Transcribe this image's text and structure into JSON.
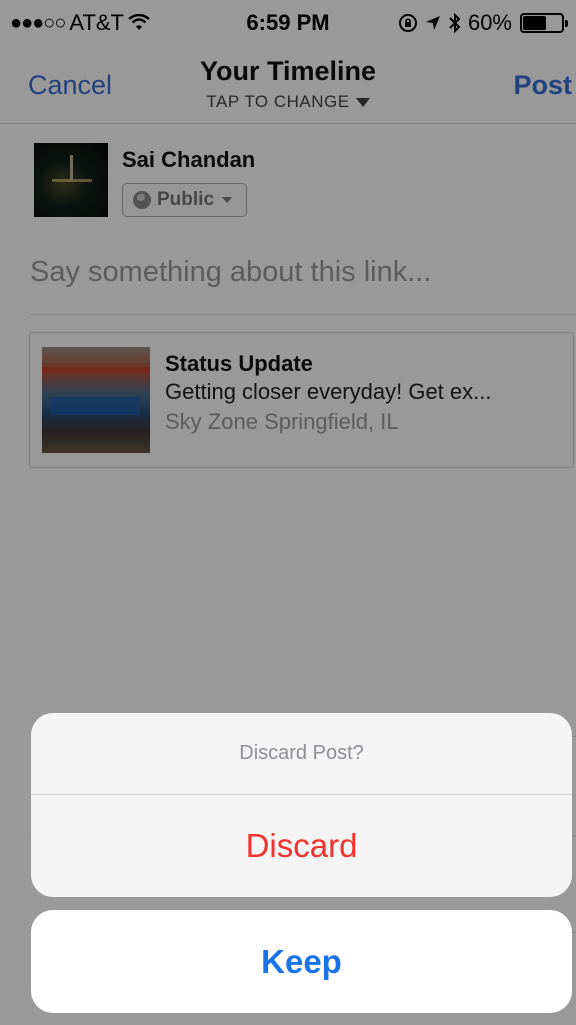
{
  "status_bar": {
    "signal": "●●●○○",
    "carrier": "AT&T",
    "wifi_icon": "wifi-icon",
    "time": "6:59 PM",
    "battery_percent": "60%",
    "battery_level": 0.6
  },
  "nav": {
    "cancel_label": "Cancel",
    "title": "Your Timeline",
    "subtitle": "TAP TO CHANGE",
    "post_label": "Post"
  },
  "composer": {
    "author_name": "Sai Chandan",
    "audience": "Public",
    "placeholder": "Say something about this link..."
  },
  "link_preview": {
    "title": "Status Update",
    "description": "Getting closer everyday! Get ex...",
    "source": "Sky Zone Springfield, IL"
  },
  "action_sheet": {
    "title": "Discard Post?",
    "discard_label": "Discard",
    "keep_label": "Keep"
  },
  "colors": {
    "link_blue": "#3b6fd1",
    "destructive_red": "#f0322e",
    "action_blue": "#1a73e8"
  }
}
